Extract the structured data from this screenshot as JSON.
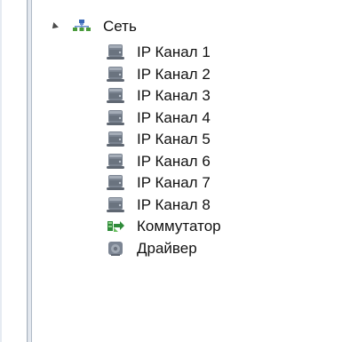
{
  "tree": {
    "root": {
      "label": "Сеть",
      "icon": "network-icon",
      "expanded": true
    },
    "children": [
      {
        "label": "IP Канал 1",
        "icon": "server-icon"
      },
      {
        "label": "IP Канал 2",
        "icon": "server-icon"
      },
      {
        "label": "IP Канал 3",
        "icon": "server-icon"
      },
      {
        "label": "IP Канал 4",
        "icon": "server-icon"
      },
      {
        "label": "IP Канал 5",
        "icon": "server-icon"
      },
      {
        "label": "IP Канал 6",
        "icon": "server-icon"
      },
      {
        "label": "IP Канал 7",
        "icon": "server-icon"
      },
      {
        "label": "IP Канал 8",
        "icon": "server-icon"
      },
      {
        "label": "Коммутатор",
        "icon": "switch-icon"
      },
      {
        "label": "Драйвер",
        "icon": "driver-icon"
      }
    ]
  },
  "colors": {
    "server": "#6f7783",
    "switch": "#2f8b3a",
    "network_blue": "#3a69b8",
    "network_green": "#4a9b3c"
  }
}
